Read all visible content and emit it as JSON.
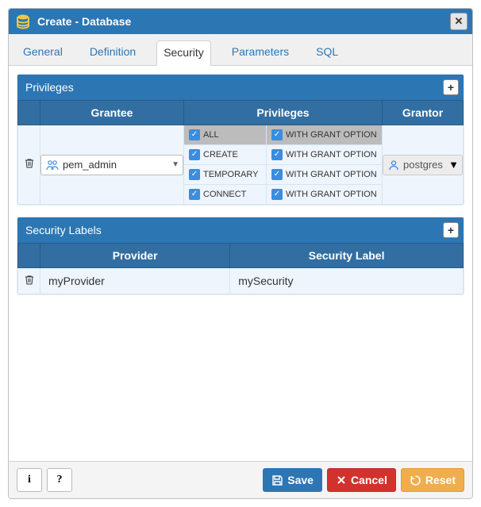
{
  "title": "Create - Database",
  "tabs": [
    "General",
    "Definition",
    "Security",
    "Parameters",
    "SQL"
  ],
  "active_tab": 2,
  "privileges": {
    "title": "Privileges",
    "headers": {
      "grantee": "Grantee",
      "privileges": "Privileges",
      "grantor": "Grantor"
    },
    "row": {
      "grantee": "pem_admin",
      "grantor": "postgres",
      "privs": [
        {
          "name": "ALL",
          "wgo": "WITH GRANT OPTION"
        },
        {
          "name": "CREATE",
          "wgo": "WITH GRANT OPTION"
        },
        {
          "name": "TEMPORARY",
          "wgo": "WITH GRANT OPTION"
        },
        {
          "name": "CONNECT",
          "wgo": "WITH GRANT OPTION"
        }
      ]
    }
  },
  "security_labels": {
    "title": "Security Labels",
    "headers": {
      "provider": "Provider",
      "label": "Security Label"
    },
    "row": {
      "provider": "myProvider",
      "label": "mySecurity"
    }
  },
  "buttons": {
    "info": "i",
    "help": "?",
    "save": "Save",
    "cancel": "Cancel",
    "reset": "Reset"
  }
}
